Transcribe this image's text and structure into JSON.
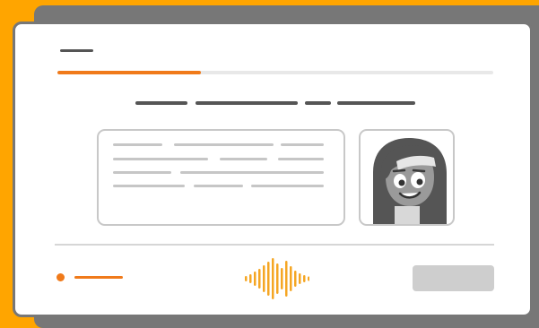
{
  "lesson": {
    "progress_fraction": 0.33,
    "continue_label": ""
  },
  "icons": {
    "waveform": "audio-waveform-icon",
    "avatar": "character-avatar-icon"
  },
  "colors": {
    "background": "#ffa500",
    "accent": "#f07a1a",
    "waveform": "#f5a623",
    "frame": "#777777",
    "placeholder": "#c6c6c6",
    "button_disabled": "#cecece"
  }
}
